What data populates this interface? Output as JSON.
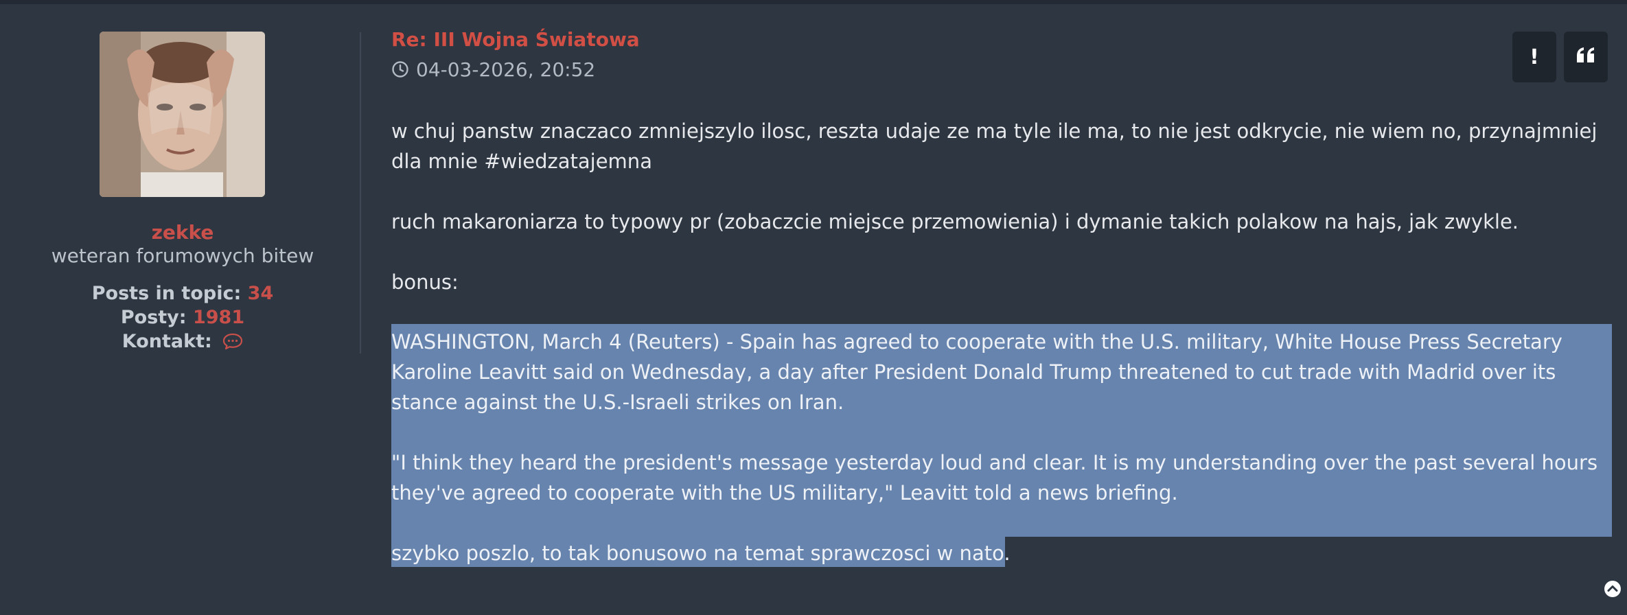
{
  "user": {
    "name": "zekke",
    "rank": "weteran forumowych bitew",
    "posts_in_topic_label": "Posts in topic:",
    "posts_in_topic_value": "34",
    "posts_label": "Posty:",
    "posts_value": "1981",
    "contact_label": "Kontakt:",
    "contact_icon": "chat-bubble-icon"
  },
  "post": {
    "title": "Re: III Wojna Światowa",
    "date": "04-03-2026, 20:52",
    "paragraphs": [
      "w chuj panstw znaczaco zmniejszylo ilosc, reszta udaje ze ma tyle ile ma, to nie jest odkrycie, nie wiem no, przynajmniej dla mnie #wiedzatajemna",
      "ruch makaroniarza to typowy pr (zobaczcie miejsce przemowienia) i dymanie takich polakow na hajs, jak zwykle.",
      "bonus:"
    ],
    "selected_paragraphs": [
      "WASHINGTON, March 4 (Reuters) - Spain has agreed to cooperate with the U.S. military, White House Press Secretary Karoline Leavitt said on Wednesday, a day after President Donald Trump threatened to cut trade with Madrid over its stance against the U.S.-Israeli strikes on Iran.",
      "\"I think they heard the president's message yesterday loud and clear. It is my understanding over the past several hours they've agreed to cooperate with the US military,\" Leavitt told a news briefing.",
      "szybko poszlo, to tak bonusowo na temat sprawczosci w nato."
    ]
  },
  "actions": {
    "report_label": "!",
    "quote_icon": "quote-icon",
    "scroll_top_icon": "arrow-up-circle-icon"
  },
  "colors": {
    "background": "#2d3641",
    "accent": "#c9504a",
    "selection": "#6684ad",
    "button": "#1f252d"
  }
}
